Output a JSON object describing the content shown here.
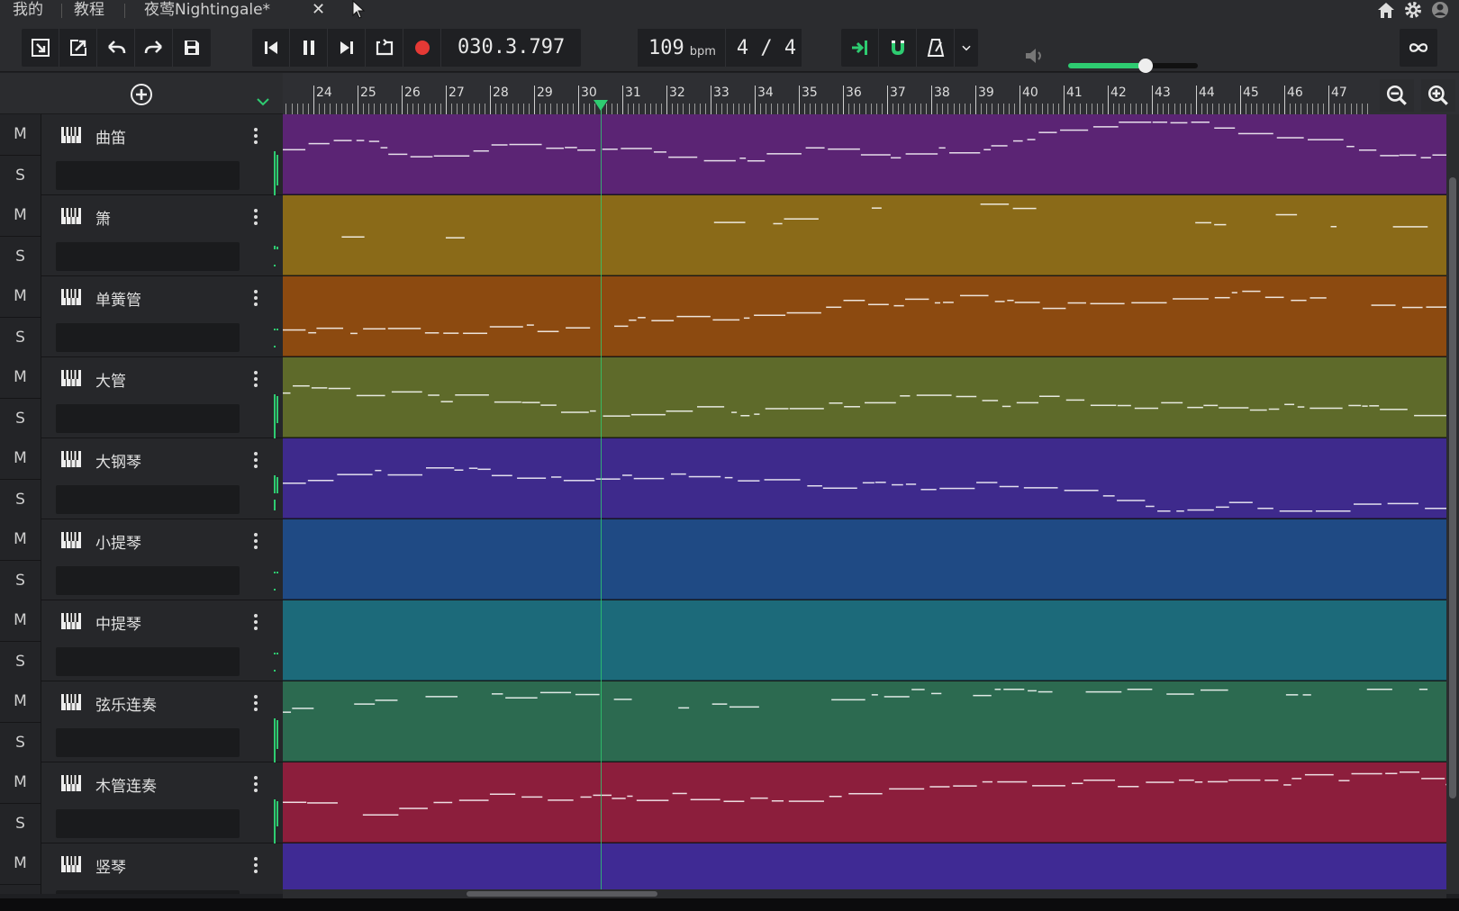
{
  "tabs": [
    {
      "label": "我的"
    },
    {
      "label": "教程"
    },
    {
      "label": "夜莺Nightingale*"
    }
  ],
  "tab_close": "✕",
  "toolbar": {
    "position": "030.3.797",
    "tempo": "109",
    "tempo_unit": "bpm",
    "time_signature": "4 / 4",
    "volume_level": 0.6,
    "meter_level": 0.4,
    "icons": {
      "import": "import-icon",
      "export": "export-icon",
      "undo": "undo-icon",
      "redo": "redo-icon",
      "save": "save-icon",
      "skip_back": "skip-back-icon",
      "pause": "pause-icon",
      "skip_forward": "skip-forward-icon",
      "loop": "loop-icon",
      "record": "record-icon",
      "follow": "follow-playhead-icon",
      "snap": "magnet-icon",
      "metronome": "metronome-icon",
      "volume": "speaker-icon",
      "infinite": "infinity-icon"
    }
  },
  "ruler": {
    "bars": [
      "24",
      "25",
      "26",
      "27",
      "28",
      "29",
      "30",
      "31",
      "32",
      "33",
      "34",
      "35",
      "36",
      "37",
      "38",
      "39",
      "40",
      "41",
      "42",
      "43",
      "44",
      "45",
      "46",
      "47"
    ],
    "playhead_bar": 30.5
  },
  "tracks": [
    {
      "name": "曲笛",
      "mute": "M",
      "solo": "S",
      "color": "#5b2474",
      "meter": [
        0.95,
        0.85,
        0.7
      ]
    },
    {
      "name": "箫",
      "mute": "M",
      "solo": "S",
      "color": "#8a6a18",
      "meter": [
        0.1,
        0.08,
        0.0
      ]
    },
    {
      "name": "单簧管",
      "mute": "M",
      "solo": "S",
      "color": "#8c4a10",
      "meter": [
        0.05,
        0.05,
        0.0
      ]
    },
    {
      "name": "大管",
      "mute": "M",
      "solo": "S",
      "color": "#5e6a2a",
      "meter": [
        0.8,
        0.75,
        0.6
      ]
    },
    {
      "name": "大钢琴",
      "mute": "M",
      "solo": "S",
      "color": "#3e2a8c",
      "meter": [
        0.5,
        0.45,
        0.3
      ]
    },
    {
      "name": "小提琴",
      "mute": "M",
      "solo": "S",
      "color": "#1f4a84",
      "meter": [
        0.05,
        0.05,
        0.0
      ]
    },
    {
      "name": "中提琴",
      "mute": "M",
      "solo": "S",
      "color": "#1c6a7a",
      "meter": [
        0.05,
        0.05,
        0.0
      ]
    },
    {
      "name": "弦乐连奏",
      "mute": "M",
      "solo": "S",
      "color": "#2c6a50",
      "meter": [
        0.85,
        0.8,
        0.7
      ]
    },
    {
      "name": "木管连奏",
      "mute": "M",
      "solo": "S",
      "color": "#8c1e3c",
      "meter": [
        0.75,
        0.7,
        0.55
      ]
    },
    {
      "name": "竖琴",
      "mute": "M",
      "solo": "S",
      "color": "#3f2a94",
      "meter": [
        0.0,
        0.0,
        0.0
      ]
    }
  ]
}
